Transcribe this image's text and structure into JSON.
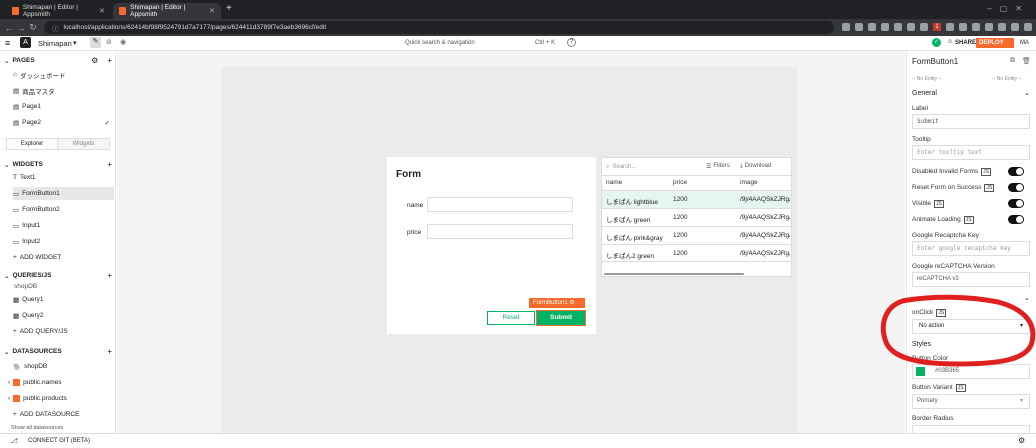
{
  "browser": {
    "tabs": [
      {
        "title": "Shimapan | Editor | Appsmith"
      },
      {
        "title": "Shimapan | Editor | Appsmith"
      }
    ],
    "new_tab": "+",
    "url": "localhost/applications/62414bf98f9524791d7a7177/pages/624411d3789f7e3aeb3696cf/edit",
    "ext_badge": "1"
  },
  "header": {
    "app_name": "Shimapan",
    "search": "Quick search & navigation",
    "shortcut": "Ctrl + K",
    "help": "?",
    "share": "SHARE",
    "deploy": "DEPLOY",
    "avatar": "MA"
  },
  "pages": {
    "title": "PAGES",
    "items": [
      "ダッシュボード",
      "商品マスタ",
      "Page1",
      "Page2"
    ]
  },
  "explorer": {
    "tab_explorer": "Explorer",
    "tab_widgets": "Widgets"
  },
  "widgets": {
    "title": "WIDGETS",
    "items": [
      "Text1",
      "FormButton1",
      "FormButton2",
      "Input1",
      "Input2"
    ],
    "add": "ADD WIDGET"
  },
  "queries": {
    "title": "QUERIES/JS",
    "group": "shopDB",
    "items": [
      "Query1",
      "Query2"
    ],
    "add": "ADD QUERY/JS"
  },
  "datasources": {
    "title": "DATASOURCES",
    "items": [
      "shopDB",
      "public.names",
      "public.products"
    ],
    "add": "ADD DATASOURCE",
    "show_all": "Show all datasources"
  },
  "footer": {
    "connect": "CONNECT GIT (BETA)"
  },
  "form": {
    "title": "Form",
    "name_label": "name",
    "price_label": "price",
    "reset": "Reset",
    "submit": "Submit",
    "selected_tag": "FormButton1"
  },
  "table": {
    "search": "Search...",
    "filters": "Filters",
    "download": "Download",
    "columns": [
      "name",
      "price",
      "image"
    ],
    "rows": [
      [
        "しまぱん lightblue",
        "1200",
        "/9j/4AAQSkZJRgABAQ"
      ],
      [
        "しまぱん green",
        "1200",
        "/9j/4AAQSkZJRgABAQ"
      ],
      [
        "しまぱん pink&gray",
        "1200",
        "/9j/4AAQSkZJRgABAQ"
      ],
      [
        "しまぱん2 green",
        "1200",
        "/9j/4AAQSkZJRgABAQ"
      ]
    ]
  },
  "props": {
    "title": "FormButton1",
    "entity_left": "-- No Entity --",
    "entity_right": "-- No Entity --",
    "general": "General",
    "label": "Label",
    "label_value": "Submit",
    "tooltip": "Tooltip",
    "tooltip_ph": "Enter tooltip text",
    "disabled": "Disabled Invalid Forms",
    "reset": "Reset Form on Success",
    "visible": "Visible",
    "animate": "Animate Loading",
    "recaptcha_key": "Google Recaptcha Key",
    "recaptcha_ph": "Enter google recaptcha key",
    "recaptcha_ver": "Google reCAPTCHA Version",
    "recaptcha_ver_value": "reCAPTCHA v3",
    "onclick": "onClick",
    "onclick_value": "No action",
    "styles": "Styles",
    "btn_color": "Button Color",
    "btn_color_value": "#03B365",
    "btn_variant": "Button Variant",
    "btn_variant_value": "Primary",
    "border_radius": "Border Radius",
    "js": "JS"
  },
  "colors": {
    "accent": "#03B365",
    "brand": "#F86A2B",
    "annotation": "#E0201F"
  }
}
